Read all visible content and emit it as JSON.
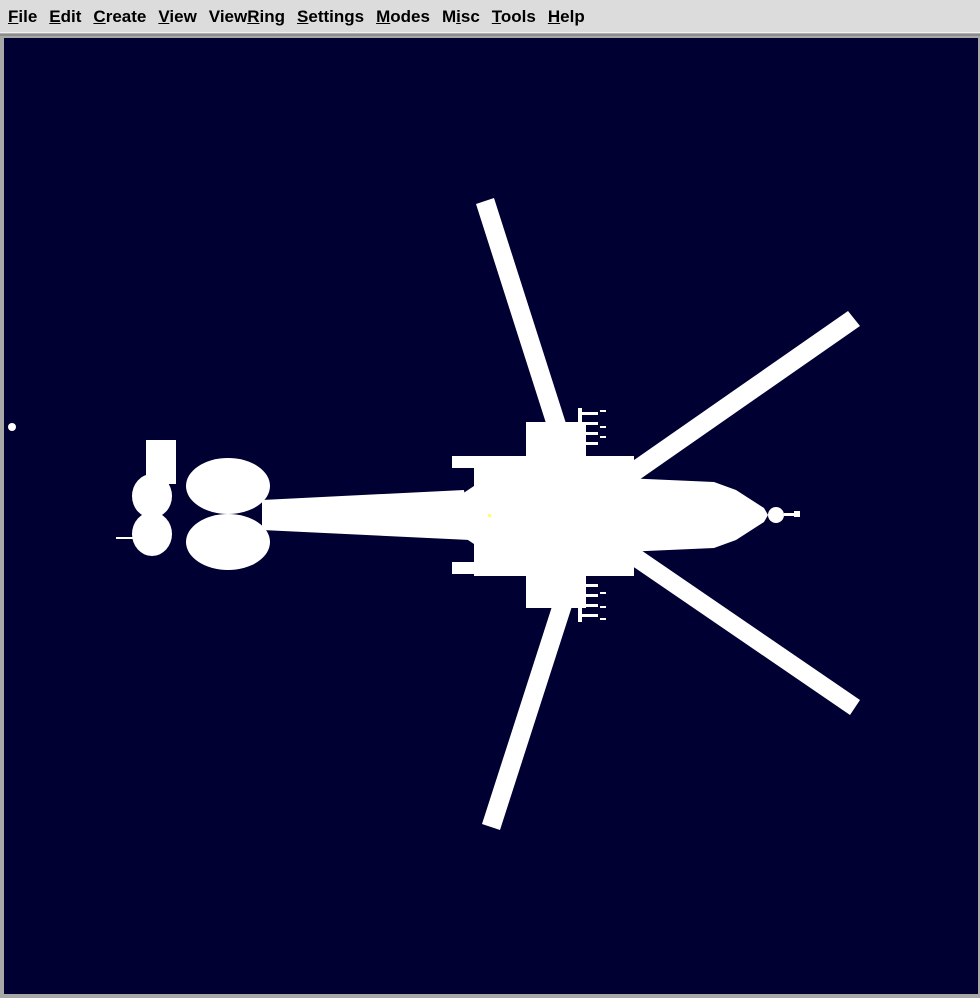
{
  "menubar": {
    "items": [
      {
        "pre": "",
        "mn": "F",
        "post": "ile",
        "name": "menu-file"
      },
      {
        "pre": "",
        "mn": "E",
        "post": "dit",
        "name": "menu-edit"
      },
      {
        "pre": "",
        "mn": "C",
        "post": "reate",
        "name": "menu-create"
      },
      {
        "pre": "",
        "mn": "V",
        "post": "iew",
        "name": "menu-view"
      },
      {
        "pre": "View",
        "mn": "R",
        "post": "ing",
        "name": "menu-viewring"
      },
      {
        "pre": "",
        "mn": "S",
        "post": "ettings",
        "name": "menu-settings"
      },
      {
        "pre": "",
        "mn": "M",
        "post": "odes",
        "name": "menu-modes"
      },
      {
        "pre": "M",
        "mn": "i",
        "post": "sc",
        "name": "menu-misc"
      },
      {
        "pre": "",
        "mn": "T",
        "post": "ools",
        "name": "menu-tools"
      },
      {
        "pre": "",
        "mn": "H",
        "post": "elp",
        "name": "menu-help"
      }
    ]
  },
  "viewport": {
    "background_color": "#000033",
    "model_color": "#ffffff",
    "model": "helicopter-top-view",
    "marker_color": "#ffff66"
  }
}
